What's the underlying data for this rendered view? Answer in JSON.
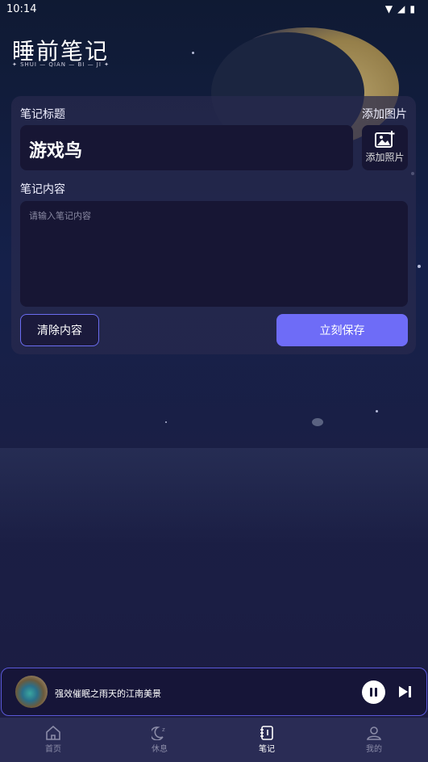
{
  "status_bar": {
    "time": "10:14"
  },
  "app": {
    "title": "睡前笔记",
    "subtitle": "✦ SHUI — QIAN — BI — JI ✦"
  },
  "form": {
    "title_label": "笔记标题",
    "add_image_label": "添加图片",
    "title_value": "游戏鸟",
    "add_photo_label": "添加照片",
    "content_label": "笔记内容",
    "content_placeholder": "请输入笔记内容",
    "clear_button": "清除内容",
    "save_button": "立刻保存"
  },
  "player": {
    "song_title": "强效催眠之雨天的江南美景",
    "state": "playing"
  },
  "tabs": [
    {
      "label": "首页",
      "icon": "home-icon",
      "active": false
    },
    {
      "label": "休息",
      "icon": "moon-icon",
      "active": false
    },
    {
      "label": "笔记",
      "icon": "notebook-icon",
      "active": true
    },
    {
      "label": "我的",
      "icon": "user-icon",
      "active": false
    }
  ],
  "colors": {
    "accent": "#6e6cf7",
    "card": "#171634",
    "tabbar": "#2a2c55"
  }
}
